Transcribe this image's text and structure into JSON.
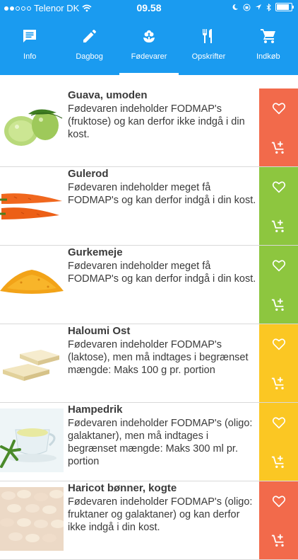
{
  "status": {
    "carrier": "Telenor DK",
    "time": "09.58",
    "signal_bars_filled": 2,
    "signal_bars_total": 5,
    "battery_level": 0.85
  },
  "tabs": [
    {
      "label": "Info",
      "icon": "message-icon",
      "active": false
    },
    {
      "label": "Dagbog",
      "icon": "pencil-icon",
      "active": false
    },
    {
      "label": "Fødevarer",
      "icon": "flower-icon",
      "active": true
    },
    {
      "label": "Opskrifter",
      "icon": "cutlery-icon",
      "active": false
    },
    {
      "label": "Indkøb",
      "icon": "cart-icon",
      "active": false
    }
  ],
  "colors": {
    "header": "#1a9bf0",
    "red": "#f26a4b",
    "green": "#8dc63f",
    "yellow": "#fbc723"
  },
  "foods": [
    {
      "name": "Guava, umoden",
      "description": "Fødevaren indeholder FODMAP's (fruktose) og kan derfor ikke indgå i din kost.",
      "status": "red",
      "image": "guava"
    },
    {
      "name": "Gulerod",
      "description": "Fødevaren indeholder meget få FODMAP's og kan derfor indgå i din kost.",
      "status": "green",
      "image": "carrot"
    },
    {
      "name": "Gurkemeje",
      "description": "Fødevaren indeholder meget få FODMAP's og kan derfor indgå i din kost.",
      "status": "green",
      "image": "turmeric"
    },
    {
      "name": "Haloumi Ost",
      "description": "Fødevaren indeholder FODMAP's (laktose), men må indtages i begrænset mængde: Maks 100 g pr. portion",
      "status": "yellow",
      "image": "halloumi"
    },
    {
      "name": "Hampedrik",
      "description": "Fødevaren indeholder FODMAP's (oligo: galaktaner), men må indtages i begrænset mængde: Maks 300 ml pr. portion",
      "status": "yellow",
      "image": "hemp-drink"
    },
    {
      "name": "Haricot bønner, kogte",
      "description": "Fødevaren indeholder FODMAP's (oligo: fruktaner og galaktaner) og kan derfor ikke indgå i din kost.",
      "status": "red",
      "image": "beans"
    }
  ]
}
